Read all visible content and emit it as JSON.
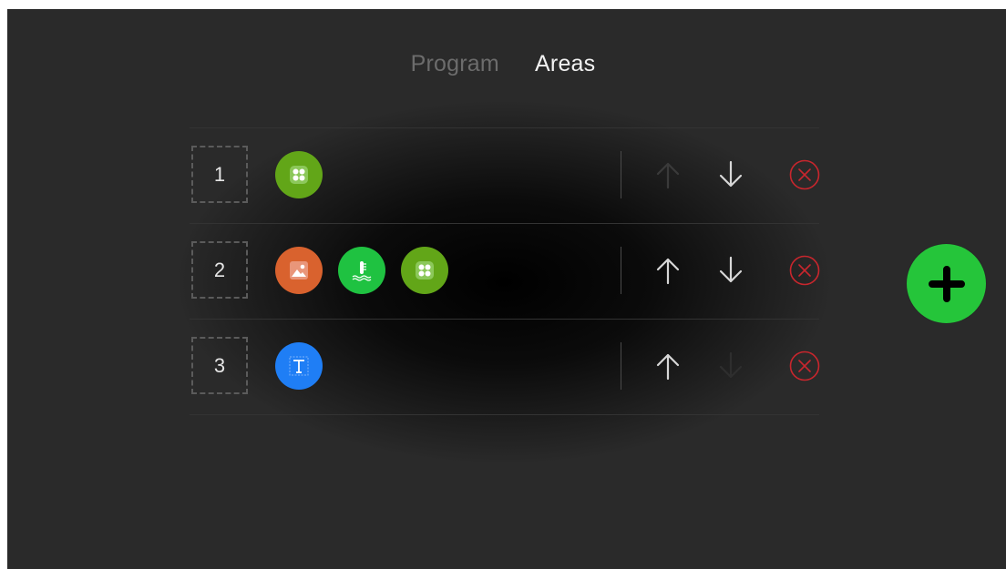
{
  "tabs": [
    {
      "label": "Program",
      "active": false
    },
    {
      "label": "Areas",
      "active": true
    }
  ],
  "areas": [
    {
      "number": "1",
      "apps": [
        "grid-app-icon"
      ],
      "up_enabled": false,
      "down_enabled": true
    },
    {
      "number": "2",
      "apps": [
        "image-app-icon",
        "thermometer-app-icon",
        "grid-app-icon"
      ],
      "up_enabled": true,
      "down_enabled": true
    },
    {
      "number": "3",
      "apps": [
        "text-app-icon"
      ],
      "up_enabled": true,
      "down_enabled": false
    }
  ],
  "colors": {
    "accent_green": "#25c53a",
    "delete_red": "#c8262d",
    "grid_app": "#62a618",
    "image_app": "#d9622e",
    "thermometer_app": "#1fc241",
    "text_app": "#1f7ef5"
  },
  "fab": {
    "icon": "plus-icon"
  }
}
